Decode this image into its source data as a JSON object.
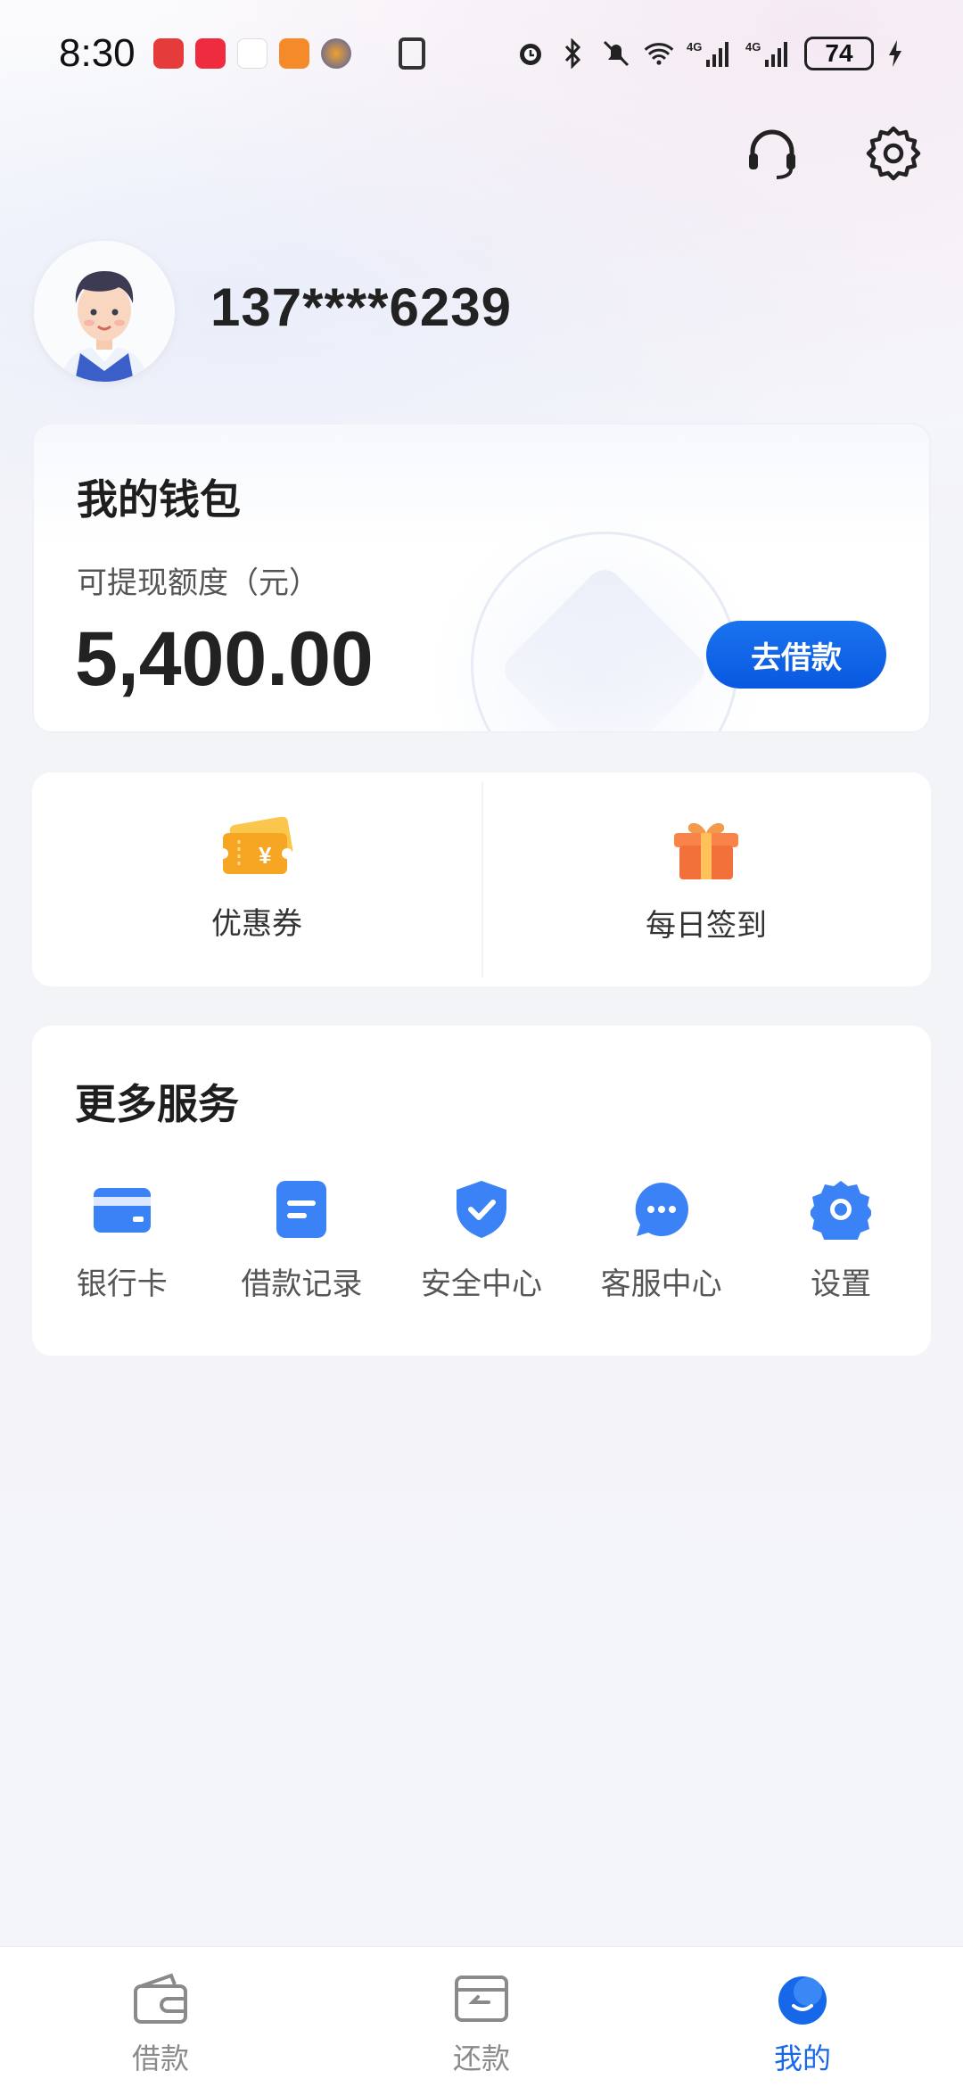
{
  "status_bar": {
    "time": "8:30",
    "battery": "74",
    "icons": [
      "alarm-icon",
      "bluetooth-icon",
      "mute-icon",
      "wifi-icon",
      "signal-4g-icon",
      "signal-4g-icon",
      "charging-icon"
    ],
    "notification_apps": [
      {
        "name": "huawei-app-icon",
        "color": "#e63b3b"
      },
      {
        "name": "redbook-app-icon",
        "color": "#ef2b3f"
      },
      {
        "name": "sant-app-icon",
        "color": "#ffffff"
      },
      {
        "name": "video-app-icon",
        "color": "#f48a2a"
      },
      {
        "name": "game-app-icon",
        "color": "#5a6fb0"
      }
    ]
  },
  "header": {
    "support_icon": "headset-icon",
    "settings_icon": "gear-icon"
  },
  "profile": {
    "phone": "137****6239"
  },
  "wallet": {
    "title": "我的钱包",
    "label": "可提现额度（元）",
    "amount": "5,400.00",
    "button": "去借款"
  },
  "quick_actions": [
    {
      "label": "优惠券",
      "icon": "coupon-icon",
      "color": "#f6a623"
    },
    {
      "label": "每日签到",
      "icon": "gift-icon",
      "color": "#f2703a"
    }
  ],
  "services": {
    "title": "更多服务",
    "items": [
      {
        "label": "银行卡",
        "icon": "bank-card-icon"
      },
      {
        "label": "借款记录",
        "icon": "loan-record-icon"
      },
      {
        "label": "安全中心",
        "icon": "shield-check-icon"
      },
      {
        "label": "客服中心",
        "icon": "chat-bubble-icon"
      },
      {
        "label": "设置",
        "icon": "settings-gear-icon"
      }
    ],
    "icon_color": "#3b82f6"
  },
  "bottom_nav": {
    "items": [
      {
        "label": "借款",
        "icon": "wallet-icon",
        "active": false
      },
      {
        "label": "还款",
        "icon": "repay-icon",
        "active": false
      },
      {
        "label": "我的",
        "icon": "profile-smile-icon",
        "active": true
      }
    ],
    "active_color": "#1668e8"
  }
}
